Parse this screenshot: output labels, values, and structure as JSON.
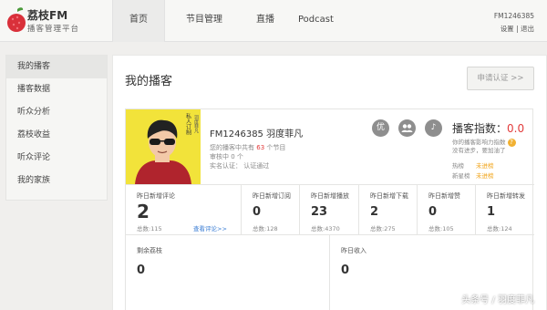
{
  "brand": {
    "title": "荔枝FM",
    "subtitle": "播客管理平台"
  },
  "nav": [
    "首页",
    "节目管理",
    "直播",
    "Podcast"
  ],
  "user": {
    "id": "FM1246385",
    "settings": "设置",
    "separator": "|",
    "logout": "退出"
  },
  "sidebar": [
    "我的播客",
    "播客数据",
    "听众分析",
    "荔枝收益",
    "听众评论",
    "我的家族"
  ],
  "panel": {
    "title": "我的播客",
    "apply_button": "申请认证 >>"
  },
  "avatar": {
    "text_line1": "私人订",
    "text_line2": "制",
    "cn": "羽度菲凡"
  },
  "profile": {
    "name": "FM1246385 羽度菲凡",
    "programs_prefix": "您的播客中共有",
    "programs_count": "63",
    "programs_suffix": "个节目",
    "pending": "审核中 0 个",
    "verify": "实名认证： 认证通过"
  },
  "badges": [
    "优",
    "群",
    "♪"
  ],
  "podcast_index": {
    "title": "播客指数：",
    "value": "0.0",
    "sub1": "你的播客影响力指数",
    "sub2": "没有进步，要加油了",
    "rows": [
      {
        "k": "热榜",
        "v": "未进榜"
      },
      {
        "k": "新星榜",
        "v": "未进榜"
      }
    ]
  },
  "stats": [
    {
      "label": "昨日新增评论",
      "value": "2",
      "total": "总数:115",
      "link": "查看评论>>"
    },
    {
      "label": "昨日新增订阅",
      "value": "0",
      "total": "总数:128"
    },
    {
      "label": "昨日新增播放",
      "value": "23",
      "total": "总数:4370"
    },
    {
      "label": "昨日新增下载",
      "value": "2",
      "total": "总数:275"
    },
    {
      "label": "昨日新增赞",
      "value": "0",
      "total": "总数:105"
    },
    {
      "label": "昨日新增转发",
      "value": "1",
      "total": "总数:124"
    }
  ],
  "bottom": [
    {
      "label": "剩余荔枝",
      "value": "0"
    },
    {
      "label": "昨日收入",
      "value": "0"
    }
  ],
  "watermark": "头条号 / 羽度菲凡",
  "colors": {
    "accent_red": "#e23b3b",
    "orange": "#f1a41a",
    "link_blue": "#3b7ed4",
    "badge_gray": "#8e8e8e"
  }
}
